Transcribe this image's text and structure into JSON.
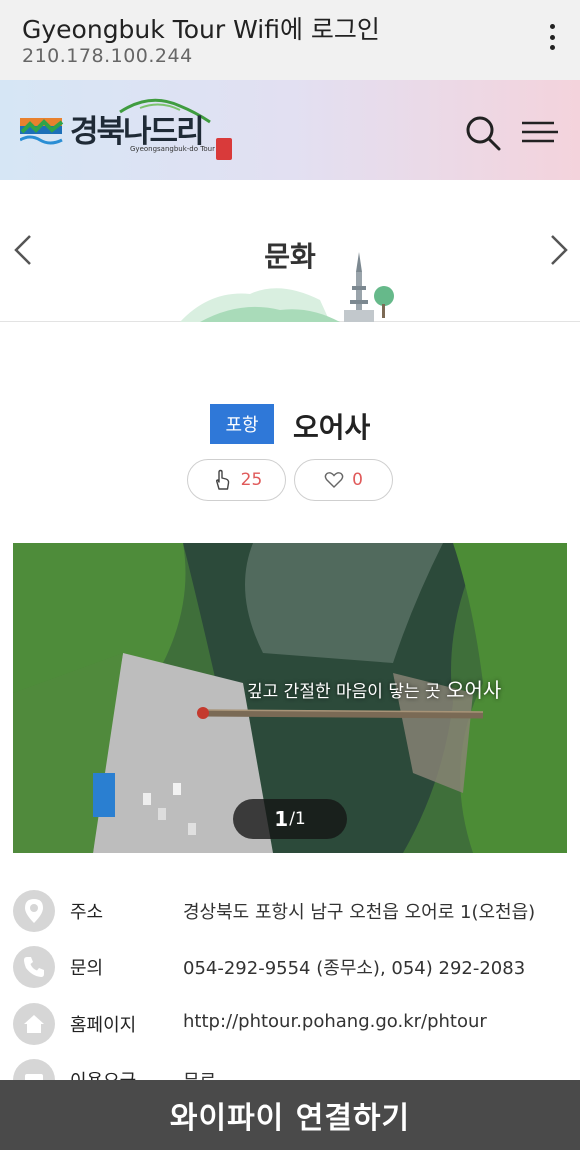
{
  "portal": {
    "title": "Gyeongbuk Tour Wifi에 로그인",
    "ip": "210.178.100.244"
  },
  "header": {
    "logo_text": "경북나드리",
    "logo_sub": "Gyeongsangbuk-do Tour",
    "search_icon": "search-icon",
    "menu_icon": "hamburger-menu-icon"
  },
  "category": {
    "title": "문화"
  },
  "place": {
    "region": "포항",
    "name": "오어사",
    "likes": "25",
    "favorites": "0"
  },
  "photo": {
    "caption_prefix": "깊고 간절한 마음이 닿는 곳",
    "caption_name": "오어사",
    "current": "1",
    "total": "/1"
  },
  "info": [
    {
      "icon": "location-pin-icon",
      "label": "주소",
      "value": "경상북도 포항시 남구 오천읍 오어로 1(오천읍)"
    },
    {
      "icon": "phone-icon",
      "label": "문의",
      "value": "054-292-9554 (종무소), 054) 292-2083"
    },
    {
      "icon": "home-icon",
      "label": "홈페이지",
      "value": "http://phtour.pohang.go.kr/phtour"
    },
    {
      "icon": "fee-icon",
      "label": "이용요금",
      "value": "무료"
    }
  ],
  "connect_button": "와이파이 연결하기",
  "colors": {
    "badge": "#2f78d8",
    "count": "#e05a5a",
    "connect_bar": "#4a4a4a"
  }
}
